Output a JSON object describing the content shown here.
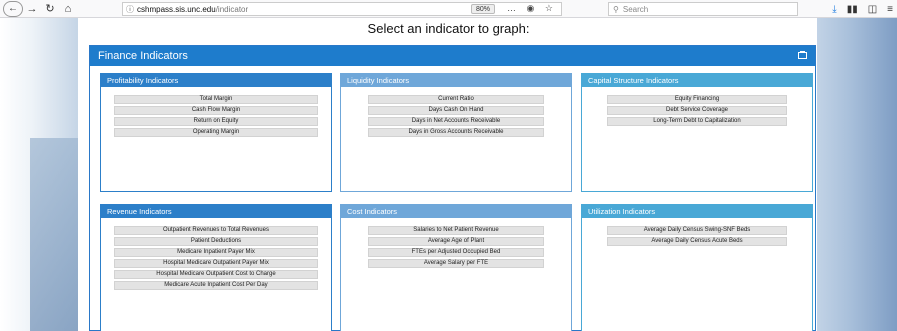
{
  "browser": {
    "url_domain": "cshmpass.sis.unc.edu",
    "url_path": "/indicator",
    "zoom": "80%",
    "search_placeholder": "Search",
    "more_icon": "…",
    "info_icon": "ⓘ"
  },
  "page": {
    "title": "Select an indicator to graph:"
  },
  "panel": {
    "title": "Finance Indicators"
  },
  "cards": [
    {
      "title": "Profitability Indicators",
      "header_color": "#2c7fc9",
      "items": [
        "Total Margin",
        "Cash Flow Margin",
        "Return on Equity",
        "Operating Margin"
      ]
    },
    {
      "title": "Liquidity Indicators",
      "header_color": "#6fa7d9",
      "items": [
        "Current Ratio",
        "Days Cash On Hand",
        "Days in Net Accounts Receivable",
        "Days in Gross Accounts Receivable"
      ]
    },
    {
      "title": "Capital Structure Indicators",
      "header_color": "#49a8d6",
      "items": [
        "Equity Financing",
        "Debt Service Coverage",
        "Long-Term Debt to Capitalization"
      ]
    },
    {
      "title": "Revenue Indicators",
      "header_color": "#2c7fc9",
      "items": [
        "Outpatient Revenues to Total Revenues",
        "Patient Deductions",
        "Medicare Inpatient Payer Mix",
        "Hospital Medicare Outpatient Payer Mix",
        "Hospital Medicare Outpatient Cost to Charge",
        "Medicare Acute Inpatient Cost Per Day"
      ]
    },
    {
      "title": "Cost Indicators",
      "header_color": "#6fa7d9",
      "items": [
        "Salaries to Net Patient Revenue",
        "Average Age of Plant",
        "FTEs per Adjusted Occupied Bed",
        "Average Salary per FTE"
      ]
    },
    {
      "title": "Utilization Indicators",
      "header_color": "#49a8d6",
      "items": [
        "Average Daily Census Swing-SNF Beds",
        "Average Daily Census Acute Beds"
      ]
    }
  ]
}
